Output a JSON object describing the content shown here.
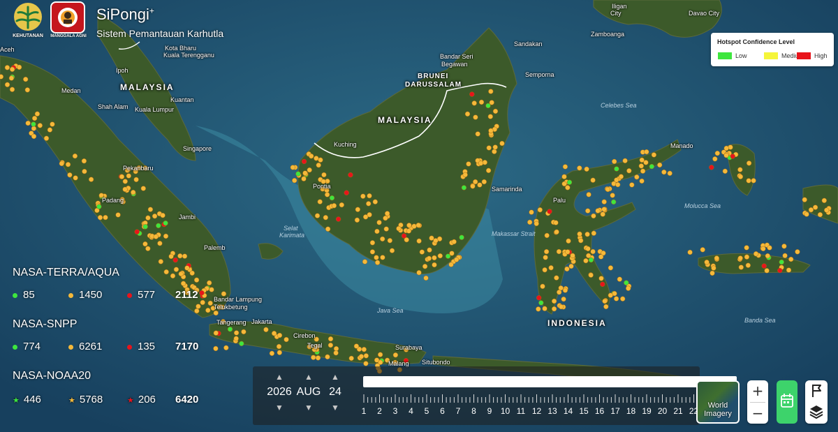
{
  "header": {
    "logo1_text": "KEHUTANAN",
    "logo2_text": "MANGGALA AGNI",
    "app_title": "SiPongi",
    "app_title_sup": "+",
    "app_subtitle": "Sistem Pemantauan Karhutla"
  },
  "legend": {
    "title": "Hotspot Confidence Level",
    "items": [
      {
        "label": "Low",
        "color": "#3ee63e"
      },
      {
        "label": "Medium",
        "color": "#f5f53a"
      },
      {
        "label": "High",
        "color": "#e8141b"
      }
    ]
  },
  "map_labels": {
    "malaysia_w": "MALAYSIA",
    "malaysia_e": "MALAYSIA",
    "indonesia": "INDONESIA",
    "brunei": "BRUNEI",
    "darussalam": "DARUSSALAM",
    "cities": {
      "bandar": "Bandar Seri",
      "begawan": "Begawan",
      "kuching": "Kuching",
      "singapore": "Singapore",
      "kuala_lumpur": "Kuala Lumpur",
      "medan": "Medan",
      "shah_alam": "Shah Alam",
      "kuantan": "Kuantan",
      "kuala_terengganu": "Kuala Terengganu",
      "ipoh": "Ipoh",
      "pekanbaru": "Pekanbaru",
      "padang": "Padang",
      "jambi": "Jambi",
      "palembang": "Palemb",
      "bandar_lampung": "Bandar Lampung",
      "jakarta": "Jakarta",
      "tangerang": "Tangerang",
      "cirebon": "Cirebon",
      "tegal": "Tegal",
      "surabaya": "Surabaya",
      "malang": "Malang",
      "situbondo": "Situbondo",
      "samarinda": "Samarinda",
      "palu": "Palu",
      "manado": "Manado",
      "sandakan": "Sandakan",
      "semporna": "Semporna",
      "davao": "Davao City",
      "kota_bharu": "Kota Bharu",
      "aceh": "Aceh",
      "pontianak": "Pontia",
      "zamboanga": "Zamboanga",
      "iligan": "Iligan",
      "city": "City",
      "teluk_betung": "Telukbetung",
      "karimata": "Karimata",
      "selat": "Selat"
    },
    "seas": {
      "celebes": "Celebes Sea",
      "java": "Java Sea",
      "makassar": "Makassar Strait",
      "banda": "Banda Sea",
      "molucca": "Molucca Sea"
    }
  },
  "stats": {
    "satellites": [
      {
        "name": "NASA-TERRA/AQUA",
        "low": "85",
        "medium": "1450",
        "high": "577",
        "total": "2112",
        "marker": "dot"
      },
      {
        "name": "NASA-SNPP",
        "low": "774",
        "medium": "6261",
        "high": "135",
        "total": "7170",
        "marker": "dot"
      },
      {
        "name": "NASA-NOAA20",
        "low": "446",
        "medium": "5768",
        "high": "206",
        "total": "6420",
        "marker": "star"
      }
    ]
  },
  "date": {
    "year": "2026",
    "month": "AUG",
    "day": "24"
  },
  "timeline": {
    "ticks": [
      "1",
      "2",
      "3",
      "4",
      "5",
      "6",
      "7",
      "8",
      "9",
      "10",
      "11",
      "12",
      "13",
      "14",
      "15",
      "16",
      "17",
      "18",
      "19",
      "20",
      "21",
      "22"
    ]
  },
  "controls": {
    "basemap_label_1": "World",
    "basemap_label_2": "Imagery",
    "zoom_in": "+",
    "zoom_out": "−"
  },
  "colors": {
    "low": "#3ee63e",
    "medium": "#f5b93a",
    "high": "#e8141b",
    "ocean": "#1d4a66",
    "land": "#3e5a2c"
  }
}
